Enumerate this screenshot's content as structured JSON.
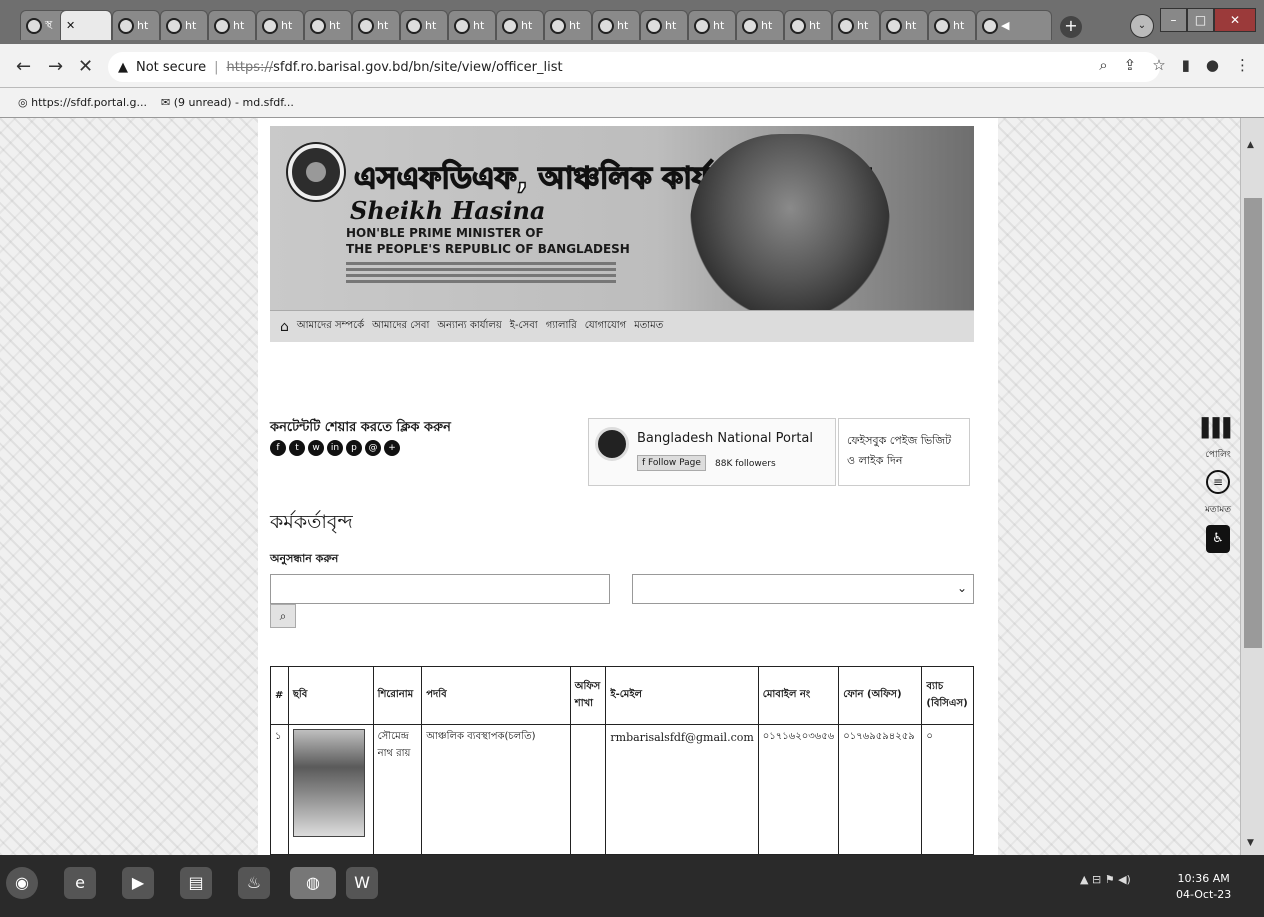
{
  "browser": {
    "tab_labels": [
      "স্থ",
      "ht",
      "ht",
      "ht",
      "ht",
      "ht",
      "ht",
      "ht",
      "ht",
      "ht",
      "ht",
      "ht",
      "ht",
      "ht",
      "ht",
      "ht",
      "ht",
      "ht",
      "ht"
    ],
    "active_tab_label": "",
    "new_tab": "+",
    "security": "Not secure",
    "url_scheme": "https://",
    "url_rest": "sfdf.ro.barisal.gov.bd/bn/site/view/officer_list",
    "bookmarks": [
      "https://sfdf.portal.g...",
      "(9 unread) - md.sfdf..."
    ]
  },
  "site": {
    "title": "এসএফডিএফ, আঞ্চলিক কার্যালয়, বরিশাল",
    "signature": "Sheikh Hasina",
    "pm_line1": "HON'BLE PRIME MINISTER OF",
    "pm_line2": "THE PEOPLE'S REPUBLIC OF BANGLADESH",
    "menu": [
      "আমাদের সম্পর্কে",
      "আমাদের সেবা",
      "অন্যান্য কার্যালয়",
      "ই-সেবা",
      "গ্যালারি",
      "যোগাযোগ",
      "মতামত"
    ]
  },
  "share": {
    "title": "কনটেন্টটি শেয়ার করতে ক্লিক করুন",
    "icons": [
      "facebook-icon",
      "twitter-icon",
      "whatsapp-icon",
      "linkedin-icon",
      "print-icon",
      "email-icon",
      "share-icon"
    ]
  },
  "facebook": {
    "page_name": "Bangladesh National Portal",
    "follow_label": "Follow Page",
    "followers": "88K followers",
    "hint": "ফেইসবুক পেইজ ভিজিট ও লাইক দিন"
  },
  "officers": {
    "heading": "কর্মকর্তাবৃন্দ",
    "search_label": "অনুসন্ধান করুন",
    "search_placeholder": "",
    "columns": [
      "#",
      "ছবি",
      "শিরোনাম",
      "পদবি",
      "অফিস শাখা",
      "ই-মেইল",
      "মোবাইল নং",
      "ফোন (অফিস)",
      "ব্যাচ (বিসিএস)"
    ],
    "rows": [
      {
        "index": "১",
        "name": "সৌমেন্দ্র নাথ রায়",
        "designation": "আঞ্চলিক ব্যবস্থাপক(চলতি)",
        "branch": "",
        "email": "rmbarisalsfdf@gmail.com",
        "mobile": "০১৭১৬২০৩৬৫৬",
        "phone": "০১৭৬৯৫৯৪২৫৯",
        "batch": "০"
      }
    ]
  },
  "side_tools": {
    "polling_label": "পোলিং",
    "feedback_label": "মতামত"
  },
  "taskbar": {
    "time": "10:36 AM",
    "date": "04-Oct-23"
  }
}
